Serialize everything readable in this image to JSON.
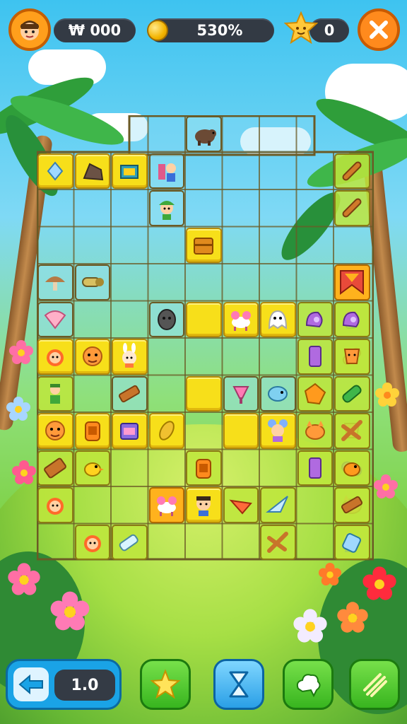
{
  "hud": {
    "score_value": "₩ 000",
    "progress_value": "530%",
    "star_count": "0",
    "icons": {
      "avatar": "player-avatar",
      "coin": "coin-icon",
      "star": "smiling-star-icon",
      "close": "close-icon"
    }
  },
  "board": {
    "columns": 9,
    "rows": 12,
    "tiles": [
      {
        "col": 4,
        "row": 0,
        "style": "c",
        "icon": "boar"
      },
      {
        "col": 0,
        "row": 1,
        "style": "y",
        "icon": "crystal"
      },
      {
        "col": 1,
        "row": 1,
        "style": "y",
        "icon": "rock"
      },
      {
        "col": 2,
        "row": 1,
        "style": "y",
        "icon": "treasure-box"
      },
      {
        "col": 3,
        "row": 1,
        "style": "c",
        "icon": "boy-with-book"
      },
      {
        "col": 8,
        "row": 1,
        "style": "g",
        "icon": "wooden-flute"
      },
      {
        "col": 3,
        "row": 2,
        "style": "c",
        "icon": "girl-green-hat"
      },
      {
        "col": 8,
        "row": 2,
        "style": "g",
        "icon": "wooden-flute"
      },
      {
        "col": 4,
        "row": 3,
        "style": "y",
        "icon": "wooden-chest"
      },
      {
        "col": 1,
        "row": 4,
        "style": "c",
        "icon": "log-pipe"
      },
      {
        "col": 0,
        "row": 4,
        "style": "c",
        "icon": "mushroom"
      },
      {
        "col": 8,
        "row": 4,
        "style": "o",
        "icon": "red-banner"
      },
      {
        "col": 0,
        "row": 5,
        "style": "c",
        "icon": "seashell"
      },
      {
        "col": 3,
        "row": 5,
        "style": "c",
        "icon": "stone-head"
      },
      {
        "col": 4,
        "row": 5,
        "style": "y",
        "icon": "blank"
      },
      {
        "col": 5,
        "row": 5,
        "style": "y",
        "icon": "pink-goat"
      },
      {
        "col": 6,
        "row": 5,
        "style": "y",
        "icon": "ghost-cat"
      },
      {
        "col": 7,
        "row": 5,
        "style": "g",
        "icon": "purple-shell"
      },
      {
        "col": 8,
        "row": 5,
        "style": "g",
        "icon": "pink-drink"
      },
      {
        "col": 9,
        "row": 5,
        "style": "g",
        "icon": "purple-shell"
      },
      {
        "col": 0,
        "row": 6,
        "style": "y",
        "icon": "red-hair-girl"
      },
      {
        "col": 1,
        "row": 6,
        "style": "y",
        "icon": "orange-face"
      },
      {
        "col": 2,
        "row": 6,
        "style": "y",
        "icon": "bunny-kid"
      },
      {
        "col": 7,
        "row": 6,
        "style": "g",
        "icon": "purple-gem"
      },
      {
        "col": 8,
        "row": 6,
        "style": "g",
        "icon": "orange-tube"
      },
      {
        "col": 9,
        "row": 6,
        "style": "g",
        "icon": "orange-cup"
      },
      {
        "col": 0,
        "row": 7,
        "style": "g",
        "icon": "green-kid"
      },
      {
        "col": 2,
        "row": 7,
        "style": "c",
        "icon": "wood-plank"
      },
      {
        "col": 4,
        "row": 7,
        "style": "y",
        "icon": "blank"
      },
      {
        "col": 5,
        "row": 7,
        "style": "c",
        "icon": "pink-bell"
      },
      {
        "col": 6,
        "row": 7,
        "style": "c",
        "icon": "blue-fish"
      },
      {
        "col": 7,
        "row": 7,
        "style": "g",
        "icon": "amber-gem"
      },
      {
        "col": 9,
        "row": 7,
        "style": "g",
        "icon": "green-bottle"
      },
      {
        "col": 0,
        "row": 8,
        "style": "y",
        "icon": "orange-face"
      },
      {
        "col": 1,
        "row": 8,
        "style": "y",
        "icon": "orange-jar"
      },
      {
        "col": 2,
        "row": 8,
        "style": "y",
        "icon": "purple-case"
      },
      {
        "col": 3,
        "row": 8,
        "style": "y",
        "icon": "gold-leaf"
      },
      {
        "col": 5,
        "row": 8,
        "style": "y",
        "icon": "blank"
      },
      {
        "col": 6,
        "row": 8,
        "style": "y",
        "icon": "mouse-girl"
      },
      {
        "col": 7,
        "row": 8,
        "style": "g",
        "icon": "orange-cat"
      },
      {
        "col": 8,
        "row": 8,
        "style": "g",
        "icon": "orange-cup"
      },
      {
        "col": 9,
        "row": 8,
        "style": "g",
        "icon": "wood-cross"
      },
      {
        "col": 0,
        "row": 9,
        "style": "g",
        "icon": "wood-phone"
      },
      {
        "col": 1,
        "row": 9,
        "style": "g",
        "icon": "yellow-bird"
      },
      {
        "col": 4,
        "row": 9,
        "style": "g",
        "icon": "orange-jar"
      },
      {
        "col": 7,
        "row": 9,
        "style": "g",
        "icon": "purple-gem"
      },
      {
        "col": 8,
        "row": 9,
        "style": "g",
        "icon": "purple-pill"
      },
      {
        "col": 9,
        "row": 9,
        "style": "g",
        "icon": "orange-bird"
      },
      {
        "col": 0,
        "row": 10,
        "style": "g",
        "icon": "red-hair-girl"
      },
      {
        "col": 3,
        "row": 10,
        "style": "o",
        "icon": "pink-goat"
      },
      {
        "col": 4,
        "row": 10,
        "style": "y",
        "icon": "boy-face"
      },
      {
        "col": 5,
        "row": 10,
        "style": "g",
        "icon": "red-chip"
      },
      {
        "col": 6,
        "row": 10,
        "style": "g",
        "icon": "blue-arrow"
      },
      {
        "col": 8,
        "row": 10,
        "style": "g",
        "icon": "orange-cat"
      },
      {
        "col": 9,
        "row": 10,
        "style": "g",
        "icon": "wood-plank"
      },
      {
        "col": 1,
        "row": 11,
        "style": "g",
        "icon": "red-hair-girl"
      },
      {
        "col": 2,
        "row": 11,
        "style": "g",
        "icon": "glass-bottle"
      },
      {
        "col": 6,
        "row": 11,
        "style": "g",
        "icon": "wood-cross"
      },
      {
        "col": 8,
        "row": 11,
        "style": "g",
        "icon": "blue-kid"
      },
      {
        "col": 9,
        "row": 11,
        "style": "g",
        "icon": "blue-cup"
      }
    ]
  },
  "controls": {
    "undo_value": "1.0",
    "buttons": [
      {
        "name": "star-hint-button",
        "icon": "star-icon"
      },
      {
        "name": "shuffle-button",
        "icon": "hourglass-icon"
      },
      {
        "name": "cloud-button",
        "icon": "cloud-splash-icon"
      },
      {
        "name": "sticks-button",
        "icon": "sticks-icon"
      }
    ]
  },
  "colors": {
    "tile_yellow": "#f7df1a",
    "tile_green": "#bee63c",
    "tile_orange": "#ffb21d",
    "hud_pill": "#333a44",
    "close_orange": "#ff8a1d"
  }
}
